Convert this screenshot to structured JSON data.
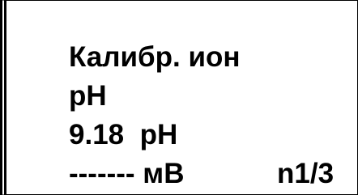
{
  "display": {
    "title": "Калибр. ион",
    "ion_unit": "pH",
    "buffer_value": "9.18  pH",
    "potential_reading": "------- мВ",
    "page": "n1/3"
  },
  "colors": {
    "background": "#ffffff",
    "text": "#000000"
  }
}
